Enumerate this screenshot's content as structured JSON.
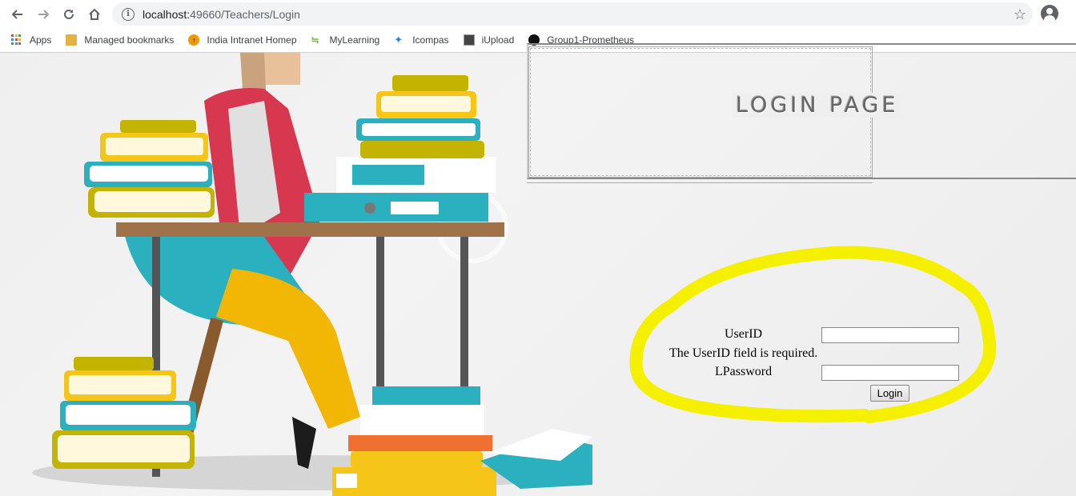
{
  "browser": {
    "url_host": "localhost:",
    "url_port_path": "49660/Teachers/Login",
    "bookmarks": [
      {
        "label": "Apps",
        "icon": "apps-grid-icon"
      },
      {
        "label": "Managed bookmarks",
        "icon": "folder-icon"
      },
      {
        "label": "India Intranet Homep",
        "icon": "india-intranet-icon"
      },
      {
        "label": "MyLearning",
        "icon": "mylearning-icon"
      },
      {
        "label": "Icompas",
        "icon": "icompas-icon"
      },
      {
        "label": "iUpload",
        "icon": "iupload-icon"
      },
      {
        "label": "Group1-Prometheus",
        "icon": "github-icon"
      }
    ]
  },
  "login": {
    "title": "LOGIN PAGE",
    "userid_label": "UserID",
    "userid_value": "",
    "userid_error": "The UserID field is required.",
    "password_label": "LPassword",
    "password_value": "",
    "submit_label": "Login"
  },
  "colors": {
    "highlight": "#f5f000",
    "accent_teal": "#2ab0bf",
    "accent_yellow": "#f5c518",
    "accent_red": "#d7374f"
  }
}
